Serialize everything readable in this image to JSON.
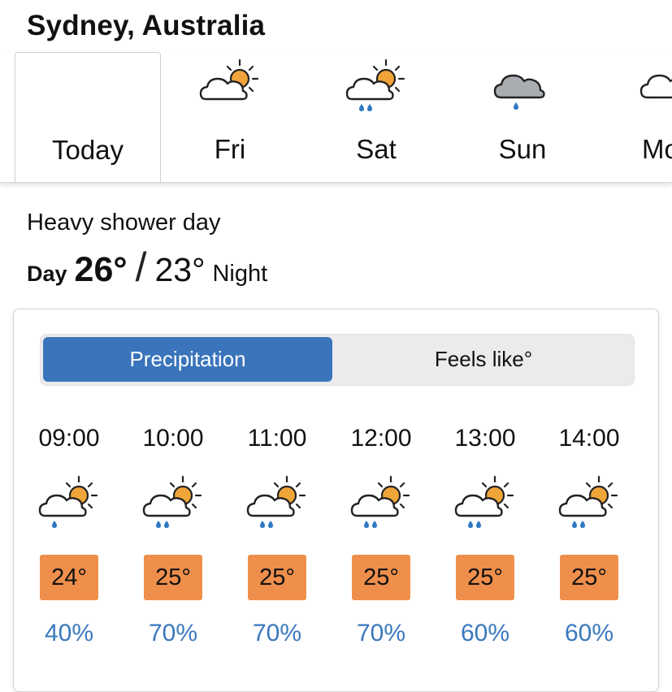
{
  "location": "Sydney, Australia",
  "days": [
    {
      "label": "Today",
      "icon": "none",
      "active": true
    },
    {
      "label": "Fri",
      "icon": "sun-cloud-icon"
    },
    {
      "label": "Sat",
      "icon": "sun-cloud-rain-icon"
    },
    {
      "label": "Sun",
      "icon": "grey-cloud-rain-icon"
    },
    {
      "label": "Mo",
      "icon": "cloud-icon"
    }
  ],
  "summary": "Heavy shower day",
  "temps": {
    "day_label": "Day",
    "day": "26°",
    "separator": "/",
    "night": "23°",
    "night_label": "Night"
  },
  "toggle": {
    "precipitation": "Precipitation",
    "feels_like": "Feels like°",
    "selected": "precipitation"
  },
  "hourly": [
    {
      "time": "09:00",
      "temp": "24°",
      "precip": "40%",
      "icon": "sun-cloud-rain-icon"
    },
    {
      "time": "10:00",
      "temp": "25°",
      "precip": "70%",
      "icon": "sun-cloud-rain-icon"
    },
    {
      "time": "11:00",
      "temp": "25°",
      "precip": "70%",
      "icon": "sun-cloud-rain-icon"
    },
    {
      "time": "12:00",
      "temp": "25°",
      "precip": "70%",
      "icon": "sun-cloud-rain-icon"
    },
    {
      "time": "13:00",
      "temp": "25°",
      "precip": "60%",
      "icon": "sun-cloud-rain-icon"
    },
    {
      "time": "14:00",
      "temp": "25°",
      "precip": "60%",
      "icon": "sun-cloud-rain-icon"
    }
  ],
  "colors": {
    "accent": "#3a74bb",
    "temp_badge": "#ef8f4b",
    "precip_text": "#3b78bd",
    "sun": "#f0a43a",
    "rain": "#2f79c4",
    "grey_cloud": "#a9adb2"
  }
}
